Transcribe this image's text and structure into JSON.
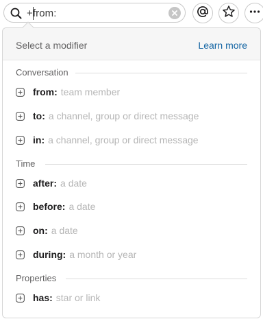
{
  "search": {
    "query": "+from:",
    "icons": {
      "search": "search-icon",
      "clear": "clear-icon"
    }
  },
  "toolbar": {
    "mentions_icon": "at-icon",
    "star_icon": "star-icon",
    "more_icon": "more-icon"
  },
  "panel": {
    "title": "Select a modifier",
    "learn_more": "Learn more",
    "sections": [
      {
        "label": "Conversation",
        "items": [
          {
            "key": "from:",
            "hint": "team member"
          },
          {
            "key": "to:",
            "hint": "a channel, group or direct message"
          },
          {
            "key": "in:",
            "hint": "a channel, group or direct message"
          }
        ]
      },
      {
        "label": "Time",
        "items": [
          {
            "key": "after:",
            "hint": "a date"
          },
          {
            "key": "before:",
            "hint": "a date"
          },
          {
            "key": "on:",
            "hint": "a date"
          },
          {
            "key": "during:",
            "hint": "a month or year"
          }
        ]
      },
      {
        "label": "Properties",
        "items": [
          {
            "key": "has:",
            "hint": "star or link"
          }
        ]
      }
    ]
  },
  "colors": {
    "link": "#1264a3",
    "hint": "#b5b5b5",
    "header_bg": "#f6f6f6"
  }
}
